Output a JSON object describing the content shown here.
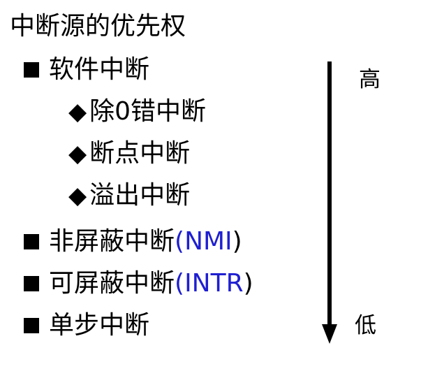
{
  "title": "中断源的优先权",
  "items": [
    {
      "label": "软件中断"
    },
    {
      "label": "除0错中断"
    },
    {
      "label": "断点中断"
    },
    {
      "label": "溢出中断"
    },
    {
      "label": "非屏蔽中断",
      "abbr": "NMI",
      "open_paren": "(",
      "close_paren": ")"
    },
    {
      "label": "可屏蔽中断",
      "abbr": "INTR",
      "open_paren": "(",
      "close_paren": ")"
    },
    {
      "label": "单步中断"
    }
  ],
  "priority": {
    "high": "高",
    "low": "低"
  },
  "bullets": {
    "diamond": "◆"
  },
  "colors": {
    "abbr_blue": "#1f1fd1",
    "text": "#000000",
    "background": "#ffffff"
  }
}
